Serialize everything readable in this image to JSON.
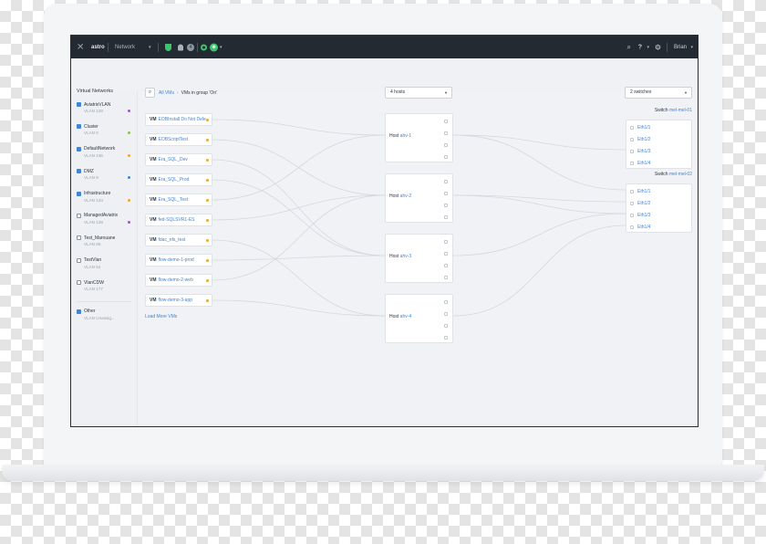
{
  "topbar": {
    "app_name": "astro",
    "network_label": "Network",
    "badge_count": "4",
    "user_name": "Brian"
  },
  "sidebar": {
    "title": "Virtual Networks",
    "items": [
      {
        "name": "AviatrixVLAN",
        "vlan": "VLAN 128",
        "checked": true,
        "dot": "#9b59b6"
      },
      {
        "name": "Cluster",
        "vlan": "VLAN 0",
        "checked": true,
        "dot": "#8bc34a"
      },
      {
        "name": "DefaultNetwork",
        "vlan": "VLAN 136",
        "checked": true,
        "dot": "#f5a623"
      },
      {
        "name": "DMZ",
        "vlan": "VLAN 9",
        "checked": true,
        "dot": "#3f85d9"
      },
      {
        "name": "Infrastructure",
        "vlan": "VLAN 134",
        "checked": true,
        "dot": "#f5a623"
      },
      {
        "name": "ManagedAviatrix",
        "vlan": "VLAN 128",
        "checked": false,
        "dot": "#9b59b6"
      },
      {
        "name": "Test_Marouane",
        "vlan": "VLAN 66",
        "checked": false,
        "dot": ""
      },
      {
        "name": "TestVlan",
        "vlan": "VLAN 54",
        "checked": false,
        "dot": ""
      },
      {
        "name": "VlanCDW",
        "vlan": "VLAN 177",
        "checked": false,
        "dot": ""
      }
    ],
    "other": {
      "name": "Other",
      "vlan": "VLAN Unassig..."
    }
  },
  "breadcrumb": {
    "root": "All VMs",
    "current": "VMs in group 'On'"
  },
  "hosts_select": "4 hosts",
  "switches_select": "2 switches",
  "vm_prefix": "VM",
  "vms": [
    "EOBInstall Do Not Dele",
    "EOBScriptTest",
    "Era_SQL_Dev",
    "Era_SQL_Prod",
    "Era_SQL_Test",
    "fed-SQLSVR1-ES",
    "fdac_nfs_test",
    "flow-demo-1-prod",
    "flow-demo-2-web",
    "flow-demo-3-app"
  ],
  "load_more": "Load More VMs",
  "host_prefix": "Host",
  "hosts": [
    "ahv-1",
    "ahv-2",
    "ahv-3",
    "ahv-4"
  ],
  "switch_prefix": "Switch",
  "switches": [
    {
      "name": "mel-mel-01",
      "ports": [
        "Eth1/1",
        "Eth1/2",
        "Eth1/3",
        "Eth1/4"
      ]
    },
    {
      "name": "mel-mel-02",
      "ports": [
        "Eth1/1",
        "Eth1/2",
        "Eth1/3",
        "Eth1/4"
      ]
    }
  ],
  "colors": {
    "accent": "#3f85d9",
    "topbar": "#232a32",
    "status_green": "#3ec46d",
    "vm_dot": "#f5a623"
  },
  "icons": [
    "close-x-icon",
    "chevron-down-icon",
    "shield-icon",
    "bell-icon",
    "status-ring-icon",
    "avatar-icon",
    "search-icon",
    "help-icon",
    "gear-icon"
  ]
}
